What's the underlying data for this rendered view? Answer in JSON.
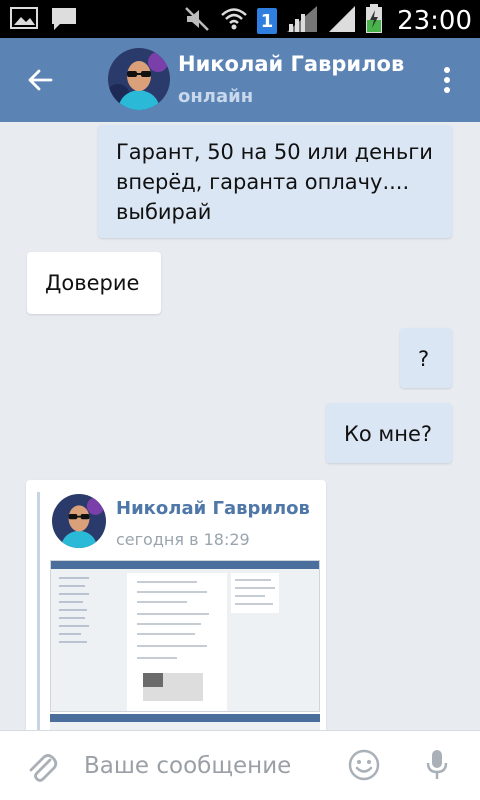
{
  "status_bar": {
    "time": "23:00",
    "sim_label": "1",
    "icons": [
      "image-notification-icon",
      "chat-notification-icon",
      "mute-icon",
      "wifi-icon",
      "signal-icon",
      "battery-charging-icon"
    ]
  },
  "header": {
    "contact_name": "Николай Гаврилов",
    "contact_status": "онлайн",
    "bg_color": "#5b83b3"
  },
  "messages": [
    {
      "direction": "out",
      "text_lines": [
        "Гарант, 50 на 50 или деньги",
        "вперёд, гаранта оплачу....",
        "выбирай"
      ]
    },
    {
      "direction": "in",
      "text": "Доверие"
    },
    {
      "direction": "out",
      "text": "?"
    },
    {
      "direction": "out",
      "text": "Ко мне?"
    }
  ],
  "forwarded": {
    "author": "Николай Гаврилов",
    "date": "сегодня в 18:29"
  },
  "input_bar": {
    "placeholder": "Ваше сообщение"
  }
}
